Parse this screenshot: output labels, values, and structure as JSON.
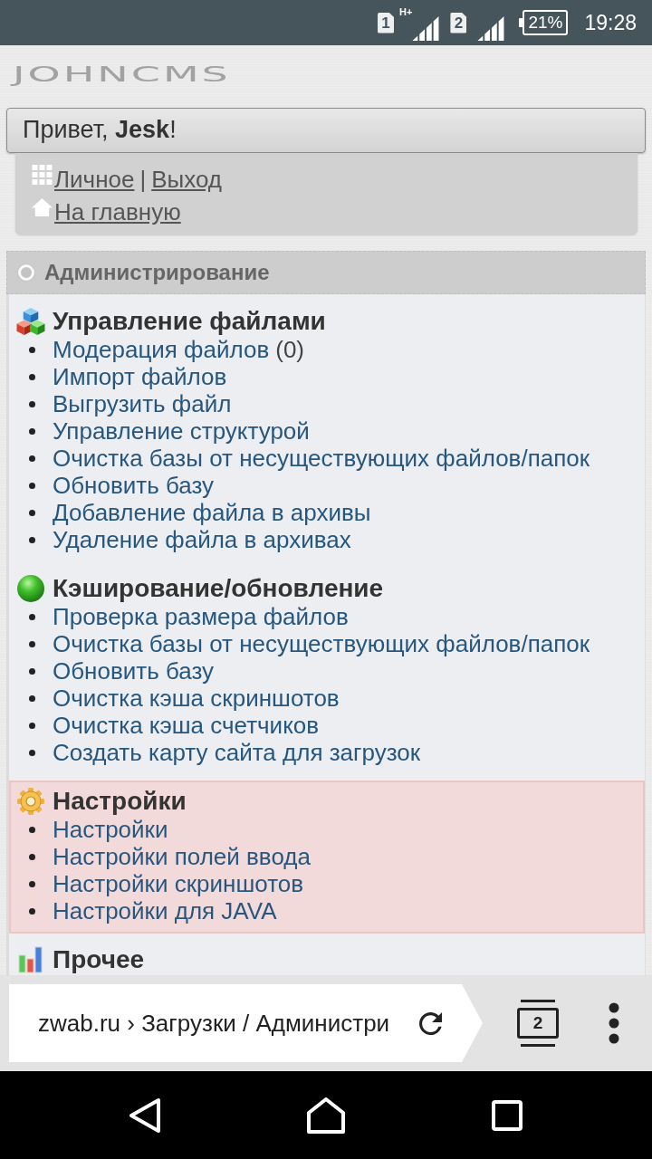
{
  "status_bar": {
    "sim_1": "1",
    "network_type": "H+",
    "sim_2": "2",
    "battery": "21%",
    "time": "19:28"
  },
  "logo": "JOHNCMS",
  "greeting": "Привет, **Jesk**!",
  "user_menu": [
    {
      "kind": "grid",
      "links": [
        "Личное",
        "Выход"
      ],
      "separator": "|"
    },
    {
      "kind": "home",
      "links": [
        "На главную"
      ]
    }
  ],
  "admin": {
    "title": "Администрирование",
    "sections": [
      {
        "kind": "cubes",
        "title": "Управление файлами",
        "highlighted": false,
        "items": [
          {
            "label": "Модерация файлов",
            "count": "(0)"
          },
          {
            "label": "Импорт файлов"
          },
          {
            "label": "Выгрузить файл"
          },
          {
            "label": "Управление структурой"
          },
          {
            "label": "Очистка базы от несуществующих файлов/папок"
          },
          {
            "label": "Обновить базу"
          },
          {
            "label": "Добавление файла в архивы"
          },
          {
            "label": "Удаление файла в архивах"
          }
        ]
      },
      {
        "kind": "sphere",
        "title": "Кэширование/обновление",
        "highlighted": false,
        "items": [
          {
            "label": "Проверка размера файлов"
          },
          {
            "label": "Очистка базы от несуществующих файлов/папок"
          },
          {
            "label": "Обновить базу"
          },
          {
            "label": "Очистка кэша скриншотов"
          },
          {
            "label": "Очистка кэша счетчиков"
          },
          {
            "label": "Создать карту сайта для загрузок"
          }
        ]
      },
      {
        "kind": "gear",
        "title": "Настройки",
        "highlighted": true,
        "items": [
          {
            "label": "Настройки"
          },
          {
            "label": "Настройки полей ввода"
          },
          {
            "label": "Настройки скриншотов"
          },
          {
            "label": "Настройки для JAVA"
          }
        ]
      },
      {
        "kind": "chart",
        "title": "Прочее",
        "highlighted": false
      }
    ]
  },
  "browser": {
    "url": "zwab.ru › Загрузки / Администри",
    "tab_count": "2"
  }
}
